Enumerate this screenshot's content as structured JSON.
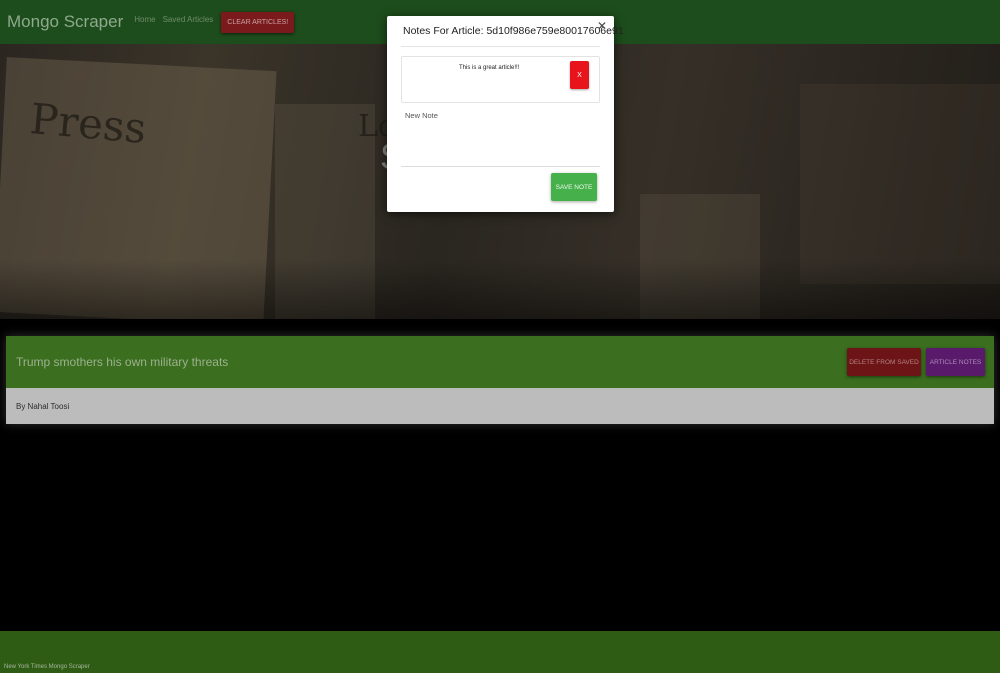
{
  "navbar": {
    "brand": "Mongo Scraper",
    "links": [
      "Home",
      "Saved Articles"
    ],
    "clear_button": "CLEAR ARTICLES!"
  },
  "hero": {
    "title": "S                  s"
  },
  "article": {
    "title": "Trump smothers his own military threats",
    "author": "By Nahal Toosi",
    "delete_button": "DELETE FROM SAVED",
    "notes_button": "ARTICLE NOTES"
  },
  "modal": {
    "title": "Notes For Article: 5d10f986e759e80017606e91",
    "close_glyph": "✕",
    "notes": [
      {
        "text": "This is a great article!!!",
        "delete_label": "X"
      }
    ],
    "new_note_label": "New Note",
    "new_note_value": "",
    "save_button": "SAVE NOTE"
  },
  "footer": {
    "text": "New York Times Mongo Scraper"
  },
  "colors": {
    "navbar": "#1d4d1c",
    "card_header": "#3b6e1f",
    "footer": "#2e5c15",
    "danger": "#e8141c",
    "save": "#46b04a",
    "notes_button": "#591a6c"
  }
}
